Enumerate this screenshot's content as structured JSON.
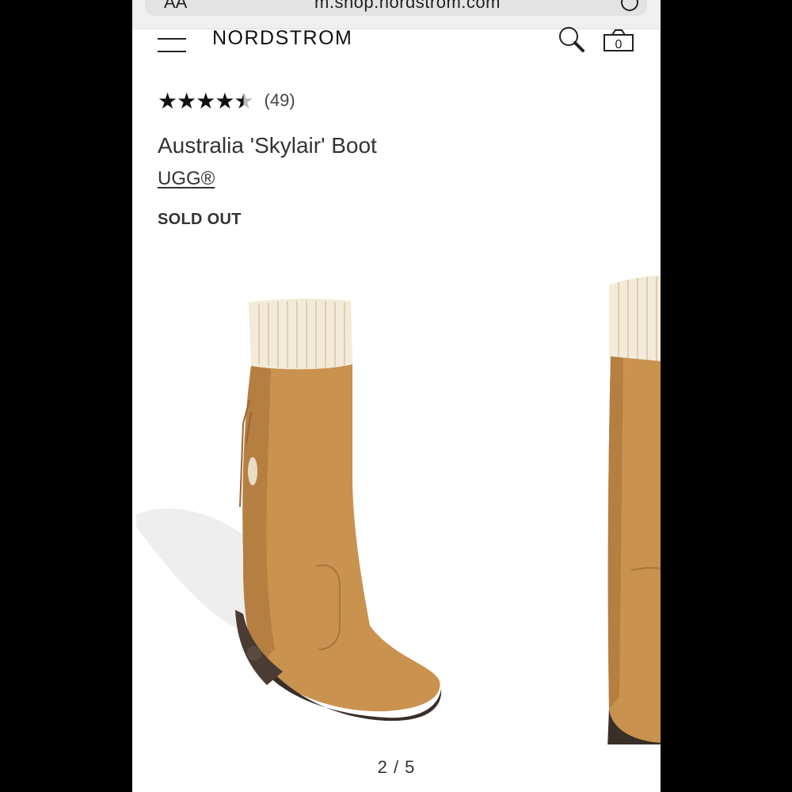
{
  "browser": {
    "text_size_label": "AA",
    "url": "m.shop.nordstrom.com"
  },
  "header": {
    "logo": "NORDSTROM",
    "bag_count": "0"
  },
  "product": {
    "rating_value": 4.5,
    "rating_max": 5,
    "review_count": "(49)",
    "title": "Australia 'Skylair' Boot",
    "brand": "UGG®",
    "status": "SOLD OUT"
  },
  "gallery": {
    "pager": "2 / 5"
  },
  "colors": {
    "boot_leather": "#c9924f",
    "knit_cuff": "#f3ead8",
    "sole": "#3a2e28"
  }
}
